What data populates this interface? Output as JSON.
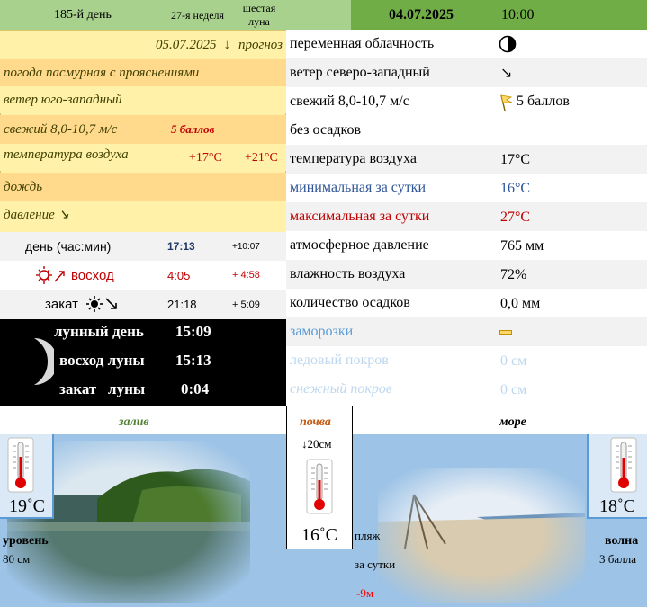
{
  "header": {
    "day_of_year": "185-й день",
    "week": "27-я неделя",
    "moon_phase": "шестая луна",
    "date": "04.07.2025",
    "time": "10:00"
  },
  "forecast": {
    "date": "05.07.2025",
    "arrow": "↓",
    "label": "прогноз",
    "weather": "погода пасмурная с прояснениями",
    "wind": "ветер юго-западный",
    "wind_strength": "свежий  8,0-10,7 м/с",
    "wind_score": "5 баллов",
    "temp_label": "температура воздуха",
    "temp_low": "+17°С",
    "temp_high": "+21°С",
    "precip": "дождь",
    "pressure": "давление ↘"
  },
  "daylight": {
    "day_label": "день (час:мин)",
    "day_length": "17:13",
    "day_delta": "+10:07",
    "sunrise_label": "восход",
    "sunrise": "4:05",
    "sunrise_delta": "+ 4:58",
    "sunset_label": "закат",
    "sunset": "21:18",
    "sunset_delta": "+ 5:09"
  },
  "moon": {
    "day_label": "лунный день",
    "day_value": "15:09",
    "rise_label": "восход луны",
    "rise_value": "15:13",
    "set_label": "закат   луны",
    "set_value": "0:04"
  },
  "current": {
    "rows": [
      {
        "label": "переменная облачность",
        "value": "",
        "icon": "half-moon-cloud-icon"
      },
      {
        "label": "ветер северо-западный",
        "value": "↘"
      },
      {
        "label": "свежий  8,0-10,7 м/с",
        "value": "5 баллов",
        "icon": "flag-icon"
      },
      {
        "label": "без осадков",
        "value": ""
      },
      {
        "label": "температура воздуха",
        "value": "17°С"
      },
      {
        "label": "минимальная за сутки",
        "value": "16°С"
      },
      {
        "label": "максимальная за сутки",
        "value": "27°С"
      },
      {
        "label": "атмосферное давление",
        "value": "765 мм"
      },
      {
        "label": "влажность воздуха",
        "value": "72%"
      },
      {
        "label": "количество осадков",
        "value": "0,0 мм"
      },
      {
        "label": "заморозки",
        "value": ""
      },
      {
        "label": "ледовый покров",
        "value": "0 см"
      },
      {
        "label": "снежный покров",
        "value": "0 см"
      }
    ]
  },
  "bottom": {
    "bay_label": "залив",
    "soil_label": "почва",
    "sea_label": "море",
    "bay_temp": "19˚С",
    "soil_depth": "↓20см",
    "soil_temp": "16˚С",
    "sea_temp": "18˚С",
    "level_label": "уровень",
    "level_value": "80 см",
    "beach_label": "пляж",
    "beach_period": "за сутки",
    "beach_change": "-9м",
    "wave_label": "волна",
    "wave_value": "3 балла"
  },
  "colors": {
    "header_light": "#a9d18e",
    "header_dark": "#70ad47",
    "min_temp": "#2f5597",
    "max_temp": "#c00000",
    "frost": "#5b9bd5",
    "faded": "#bdd7ee"
  }
}
